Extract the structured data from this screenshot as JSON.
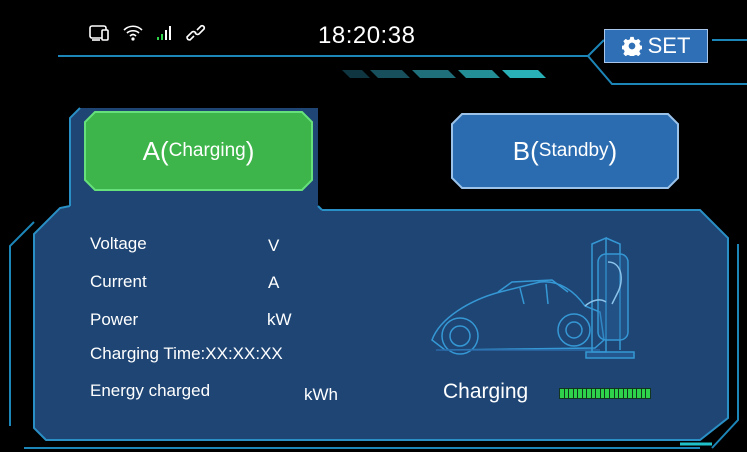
{
  "status_bar": {
    "icons": [
      "tablet-icon",
      "wifi-icon",
      "signal-icon",
      "link-icon"
    ],
    "time": "18:20:38"
  },
  "settings_button": {
    "label": "SET",
    "icon": "gear-icon"
  },
  "tabs": [
    {
      "name": "A",
      "state": "Charging",
      "active": true,
      "color": "#3cb54a"
    },
    {
      "name": "B",
      "state": "Standby",
      "active": false,
      "color": "#2b6cb0"
    }
  ],
  "readings": {
    "voltage": {
      "label": "Voltage",
      "unit": "V"
    },
    "current": {
      "label": "Current",
      "unit": "A"
    },
    "power": {
      "label": "Power",
      "unit": "kW"
    },
    "charging_time": {
      "label": "Charging Time:XX:XX:XX"
    },
    "energy": {
      "label": "Energy charged",
      "unit": "kWh"
    }
  },
  "charge_status": {
    "text": "Charging",
    "level_fraction": 1.0
  },
  "colors": {
    "panel_bg": "#1f4677",
    "frame_line": "#2a8fc4",
    "accent_cyan": "#1fc1c9",
    "active_tab": "#3cb54a",
    "inactive_tab": "#2b6cb0"
  }
}
